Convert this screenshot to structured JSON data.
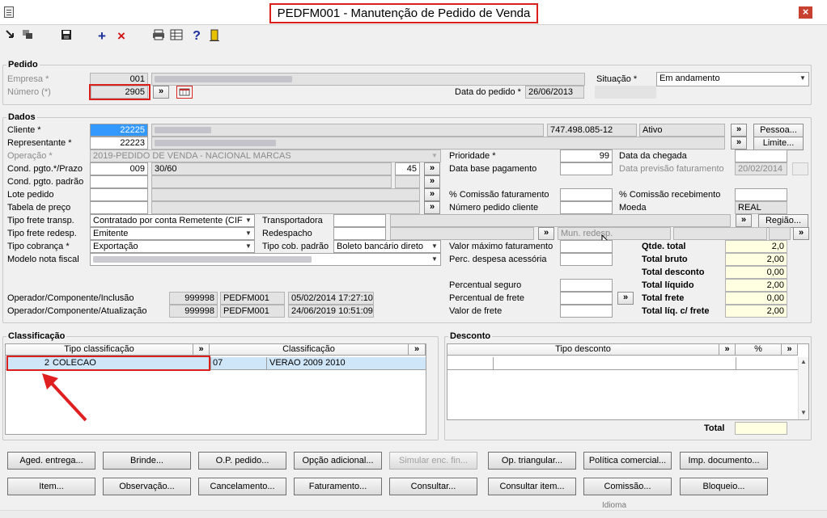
{
  "window": {
    "title": "PEDFM001 - Manutenção de Pedido de Venda",
    "close_glyph": "×"
  },
  "toolbar": {
    "add_glyph": "+",
    "delete_glyph": "×",
    "help_glyph": "?"
  },
  "pedido": {
    "section": "Pedido",
    "empresa_label": "Empresa *",
    "empresa_code": "001",
    "numero_label": "Número (*)",
    "numero": "2905",
    "data_label": "Data do pedido *",
    "data": "26/06/2013",
    "situacao_label": "Situação *",
    "situacao": "Em andamento"
  },
  "dados": {
    "section": "Dados",
    "cliente_label": "Cliente *",
    "cliente_code": "22225",
    "cliente_doc": "747.498.085-12",
    "cliente_status": "Ativo",
    "pessoa_button": "Pessoa...",
    "representante_label": "Representante *",
    "representante_code": "22223",
    "limite_button": "Limite...",
    "operacao_label": "Operação *",
    "operacao": "2019-PEDIDO DE VENDA - NACIONAL MARCAS",
    "cond_prazo_label": "Cond. pgto.*/Prazo",
    "cond_code": "009",
    "cond_desc": "30/60",
    "cond_days": "45",
    "cond_padrao_label": "Cond. pgto. padrão",
    "lote_label": "Lote pedido",
    "tabela_label": "Tabela de preço",
    "frete_transp_label": "Tipo frete transp.",
    "frete_transp": "Contratado por conta Remetente (CIF)",
    "frete_redesp_label": "Tipo frete redesp.",
    "frete_redesp": "Emitente",
    "cobranca_label": "Tipo cobrança *",
    "cobranca": "Exportação",
    "modelo_label": "Modelo nota fiscal",
    "transportadora_label": "Transportadora",
    "redespacho_label": "Redespacho",
    "cob_padrao_label": "Tipo cob. padrão",
    "cob_padrao": "Boleto bancário direto",
    "mun_redesp_placeholder": "Mun. redesp.",
    "regiao_button": "Região...",
    "prioridade_label": "Prioridade *",
    "prioridade": "99",
    "data_base_label": "Data base pagamento",
    "comissao_fat_label": "% Comissão faturamento",
    "num_cliente_label": "Número pedido cliente",
    "valor_max_label": "Valor máximo faturamento",
    "perc_despesa_label": "Perc. despesa acessória",
    "perc_seguro_label": "Percentual seguro",
    "perc_frete_label": "Percentual de frete",
    "valor_frete_label": "Valor de frete",
    "data_chegada_label": "Data da chegada",
    "data_prev_label": "Data previsão faturamento",
    "data_prev": "20/02/2014",
    "comissao_rec_label": "% Comissão recebimento",
    "moeda_label": "Moeda",
    "moeda": "REAL",
    "op_inclusao_label": "Operador/Componente/Inclusão",
    "op_inclusao_user": "999998",
    "op_inclusao_comp": "PEDFM001",
    "op_inclusao_dt": "05/02/2014 17:27:10",
    "op_atual_label": "Operador/Componente/Atualização",
    "op_atual_user": "999998",
    "op_atual_comp": "PEDFM001",
    "op_atual_dt": "24/06/2019 10:51:09"
  },
  "totals": [
    {
      "label": "Qtde. total",
      "value": "2,0"
    },
    {
      "label": "Total bruto",
      "value": "2,00"
    },
    {
      "label": "Total desconto",
      "value": "0,00"
    },
    {
      "label": "Total líquido",
      "value": "2,00"
    },
    {
      "label": "Total frete",
      "value": "0,00"
    },
    {
      "label": "Total líq. c/ frete",
      "value": "2,00"
    }
  ],
  "classificacao": {
    "section": "Classificação",
    "columns": [
      "Tipo classificação",
      "Classificação"
    ],
    "rows": [
      {
        "code": "2",
        "tipo": "COLECAO",
        "class_code": "07",
        "classificacao": "VERAO 2009 2010"
      }
    ]
  },
  "desconto": {
    "section": "Desconto",
    "columns": [
      "Tipo desconto",
      "%"
    ],
    "total_label": "Total"
  },
  "buttons_row1": [
    "Aged. entrega...",
    "Brinde...",
    "O.P. pedido...",
    "Opção adicional...",
    "Simular enc. fin...",
    "Op. triangular...",
    "Política comercial...",
    "Imp. documento..."
  ],
  "buttons_row2": [
    "Item...",
    "Observação...",
    "Cancelamento...",
    "Faturamento...",
    "Consultar...",
    "Consultar item...",
    "Comissão...",
    "Bloqueio..."
  ],
  "status_bar": {
    "idioma": "Idioma"
  },
  "arrow_glyph": "»"
}
